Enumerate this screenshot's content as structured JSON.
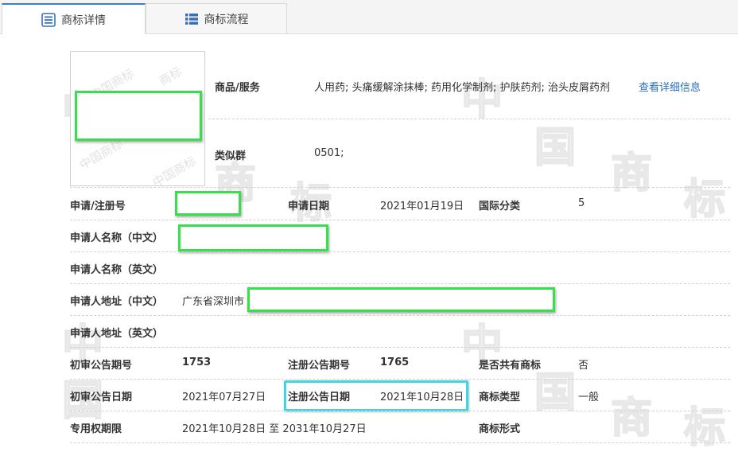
{
  "tabs": [
    {
      "label": "商标详情",
      "icon": "detail-list-icon",
      "active": true
    },
    {
      "label": "商标流程",
      "icon": "flow-list-icon",
      "active": false
    }
  ],
  "colors": {
    "accent": "#3a7fd2",
    "link": "#2a6fc0",
    "redaction_border": "#35e04a",
    "highlight_border": "#3cd6e4"
  },
  "watermark": {
    "chars": [
      "中",
      "国",
      "商",
      "标"
    ]
  },
  "goods": {
    "label": "商品/服务",
    "value": "人用药; 头痛缓解涂抹棒; 药用化学制剂; 护肤药剂; 治头皮屑药剂",
    "link": "查看详细信息"
  },
  "similar_group": {
    "label": "类似群",
    "value": "0501;"
  },
  "reg_no": {
    "label": "申请/注册号"
  },
  "apply_date": {
    "label": "申请日期",
    "value": "2021年01月19日"
  },
  "intl_class": {
    "label": "国际分类",
    "value": "5"
  },
  "applicant_cn": {
    "label": "申请人名称（中文）"
  },
  "applicant_en": {
    "label": "申请人名称（英文）"
  },
  "address_cn": {
    "label": "申请人地址（中文）",
    "value": "广东省深圳市"
  },
  "address_en": {
    "label": "申请人地址（英文）"
  },
  "prelim_issue": {
    "label": "初审公告期号",
    "value": "1753"
  },
  "reg_issue": {
    "label": "注册公告期号",
    "value": "1765"
  },
  "shared": {
    "label": "是否共有商标",
    "value": "否"
  },
  "prelim_date": {
    "label": "初审公告日期",
    "value": "2021年07月27日"
  },
  "reg_date": {
    "label": "注册公告日期",
    "value": "2021年10月28日"
  },
  "tm_type": {
    "label": "商标类型",
    "value": "一般"
  },
  "right_period": {
    "label": "专用权期限",
    "value": "2021年10月28日 至 2031年10月27日"
  },
  "tm_form": {
    "label": "商标形式"
  }
}
